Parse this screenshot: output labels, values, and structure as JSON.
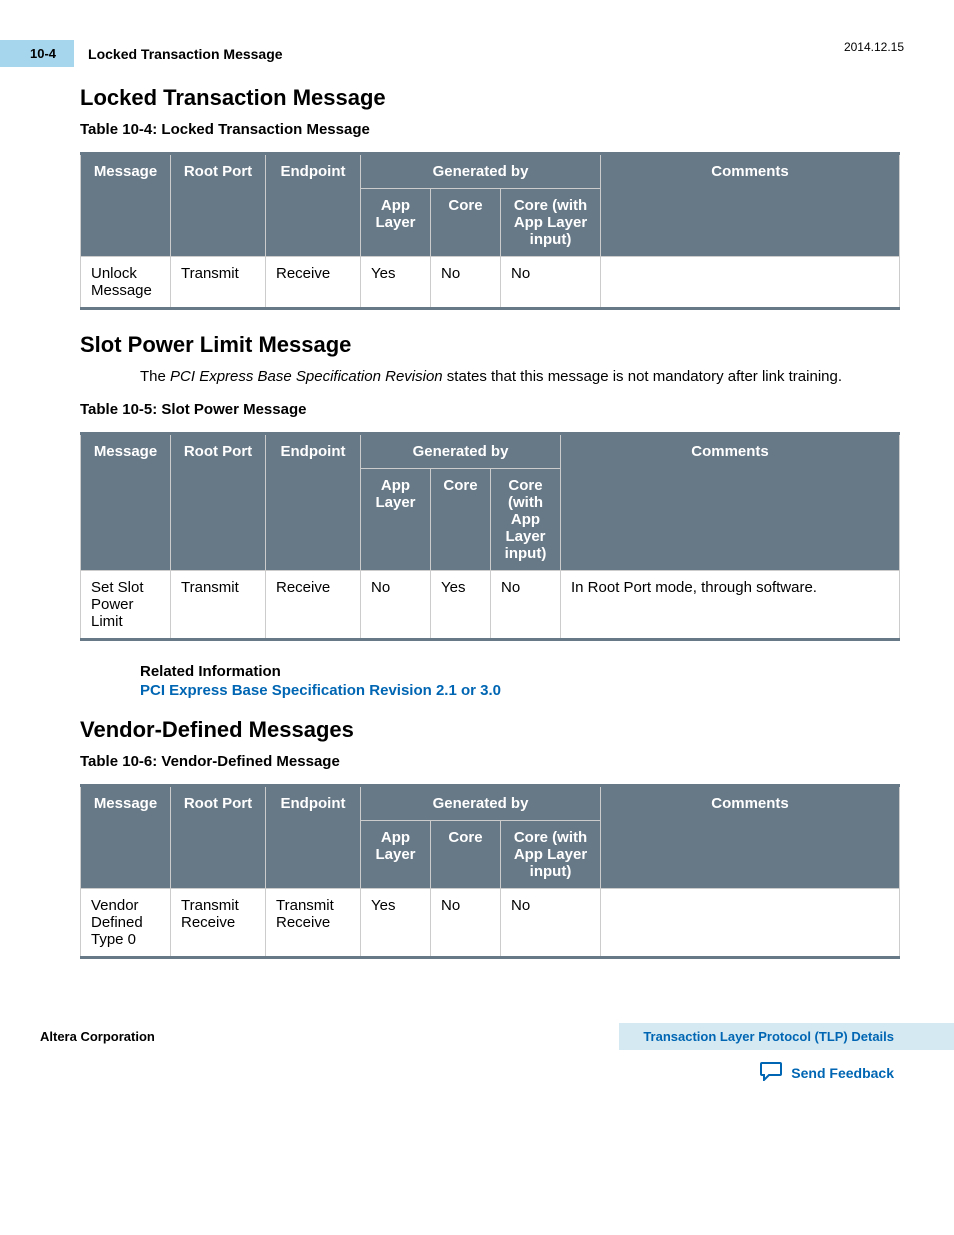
{
  "header": {
    "page_num": "10-4",
    "title": "Locked Transaction Message",
    "date": "2014.12.15"
  },
  "section1": {
    "heading": "Locked Transaction Message",
    "table_caption": "Table 10-4: Locked Transaction Message",
    "cols": {
      "message": "Message",
      "root_port": "Root Port",
      "endpoint": "Endpoint",
      "generated_by": "Generated by",
      "app_layer": "App Layer",
      "core": "Core",
      "core_app": "Core (with App Layer input)",
      "comments": "Comments"
    },
    "row": {
      "message": "Unlock Message",
      "root_port": "Transmit",
      "endpoint": "Receive",
      "app_layer": "Yes",
      "core": "No",
      "core_app": "No",
      "comments": ""
    }
  },
  "section2": {
    "heading": "Slot Power Limit Message",
    "body_pre": "The ",
    "body_em": "PCI Express Base Specification Revision",
    "body_post": " states that this message is not mandatory after link training.",
    "table_caption": "Table 10-5: Slot Power Message",
    "cols": {
      "message": "Message",
      "root_port": "Root Port",
      "endpoint": "Endpoint",
      "generated_by": "Generated by",
      "app_layer": "App Layer",
      "core": "Core",
      "core_app": "Core (with App Layer input)",
      "comments": "Comments"
    },
    "row": {
      "message": "Set Slot Power Limit",
      "root_port": "Transmit",
      "endpoint": "Receive",
      "app_layer": "No",
      "core": "Yes",
      "core_app": "No",
      "comments": "In Root Port mode, through software."
    },
    "related_head": "Related Information",
    "related_link": "PCI Express Base Specification Revision 2.1 or 3.0"
  },
  "section3": {
    "heading": "Vendor-Defined Messages",
    "table_caption": "Table 10-6: Vendor-Defined Message",
    "cols": {
      "message": "Message",
      "root_port": "Root Port",
      "endpoint": "Endpoint",
      "generated_by": "Generated by",
      "app_layer": "App Layer",
      "core": "Core",
      "core_app": "Core (with App Layer input)",
      "comments": "Comments"
    },
    "row": {
      "message": "Vendor Defined Type 0",
      "root_port": "Transmit Receive",
      "endpoint": "Transmit Receive",
      "app_layer": "Yes",
      "core": "No",
      "core_app": "No",
      "comments": ""
    }
  },
  "footer": {
    "corp": "Altera Corporation",
    "bar": "Transaction Layer Protocol (TLP) Details",
    "feedback": "Send Feedback"
  }
}
